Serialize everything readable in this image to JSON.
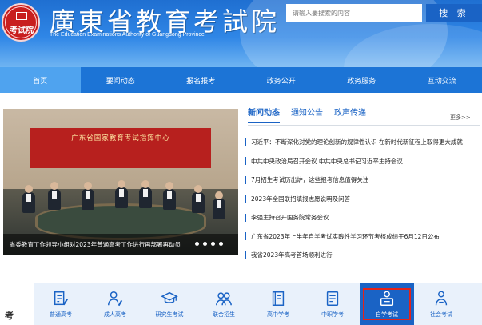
{
  "header": {
    "logo_text": "考试院",
    "title": "廣東省教育考試院",
    "subtitle": "The Education Examinations Authority of Guangdong Province"
  },
  "search": {
    "placeholder": "请输入要搜索的内容",
    "button_label": "搜 索"
  },
  "nav": {
    "items": [
      {
        "label": "首页",
        "active": true
      },
      {
        "label": "要闻动态",
        "active": false
      },
      {
        "label": "报名报考",
        "active": false
      },
      {
        "label": "政务公开",
        "active": false
      },
      {
        "label": "政务服务",
        "active": false
      },
      {
        "label": "互动交流",
        "active": false
      }
    ]
  },
  "slider": {
    "banner_text": "广东省国家教育考试指挥中心",
    "caption": "省委教育工作领导小组对2023年普通高考工作进行再部署再动员",
    "dot_count": 4
  },
  "news": {
    "tabs": [
      {
        "label": "新闻动态",
        "active": true
      },
      {
        "label": "通知公告",
        "active": false
      },
      {
        "label": "政声传递",
        "active": false
      }
    ],
    "more_label": "更多>>",
    "items": [
      "习近平：不断深化对党的理论创新的规律性认识 在新时代新征程上取得更大成就",
      "中共中央政治局召开会议 中共中央总书记习近平主持会议",
      "7月招生考试历出炉，这些报考信息值得关注",
      "2023年全国联招填报志愿说明及问答",
      "李强主持召开国务院常务会议",
      "广东省2023年上半年自学考试实践性学习环节考核成绩于6月12日公布",
      "我省2023年高考首场顺利进行"
    ]
  },
  "bottom": {
    "label": "考",
    "services": [
      {
        "label": "普通高考",
        "icon": "document-pen-icon",
        "active": false
      },
      {
        "label": "成人高考",
        "icon": "person-pen-icon",
        "active": false
      },
      {
        "label": "研究生考试",
        "icon": "graduation-cap-icon",
        "active": false
      },
      {
        "label": "联合招生",
        "icon": "people-icon",
        "active": false
      },
      {
        "label": "高中学考",
        "icon": "book-icon",
        "active": false
      },
      {
        "label": "中职学考",
        "icon": "notebook-icon",
        "active": false
      },
      {
        "label": "自学考试",
        "icon": "self-study-icon",
        "active": true
      },
      {
        "label": "社会考试",
        "icon": "person-group-icon",
        "active": false
      }
    ]
  },
  "colors": {
    "brand_blue": "#1c74d6",
    "accent_red": "#e2231a",
    "nav_active": "#4fa3ef"
  }
}
